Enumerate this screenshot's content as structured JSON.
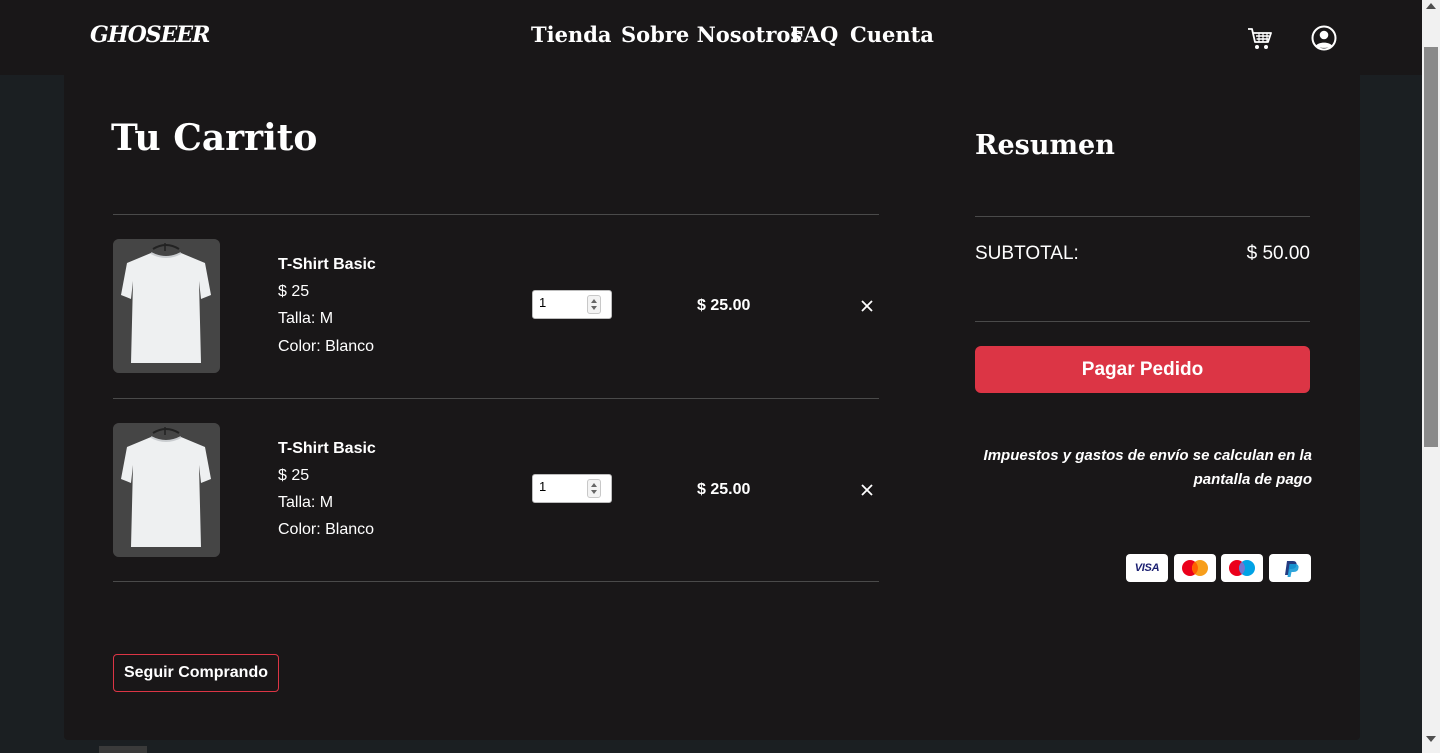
{
  "header": {
    "logo": "GHOSEER",
    "nav": [
      "Tienda",
      "Sobre Nosotros",
      "FAQ",
      "Cuenta"
    ],
    "icons": {
      "cart": "cart-icon",
      "account": "user-circle-icon"
    }
  },
  "cart": {
    "title": "Tu Carrito",
    "items": [
      {
        "name": "T-Shirt Basic",
        "price": "$ 25",
        "size": "Talla: M",
        "color": "Color: Blanco",
        "quantity": "1",
        "total": "$ 25.00"
      },
      {
        "name": "T-Shirt Basic",
        "price": "$ 25",
        "size": "Talla: M",
        "color": "Color: Blanco",
        "quantity": "1",
        "total": "$ 25.00"
      }
    ],
    "continue_label": "Seguir Comprando"
  },
  "summary": {
    "title": "Resumen",
    "subtotal_label": "SUBTOTAL:",
    "subtotal_value": "$ 50.00",
    "pay_label": "Pagar Pedido",
    "tax_note": "Impuestos y gastos de envío se calculan en la pantalla de pago",
    "payment_methods": [
      "VISA",
      "Mastercard",
      "Maestro",
      "PayPal"
    ]
  },
  "colors": {
    "accent": "#dc3545",
    "panel": "#191718",
    "background": "#1b1f22"
  }
}
